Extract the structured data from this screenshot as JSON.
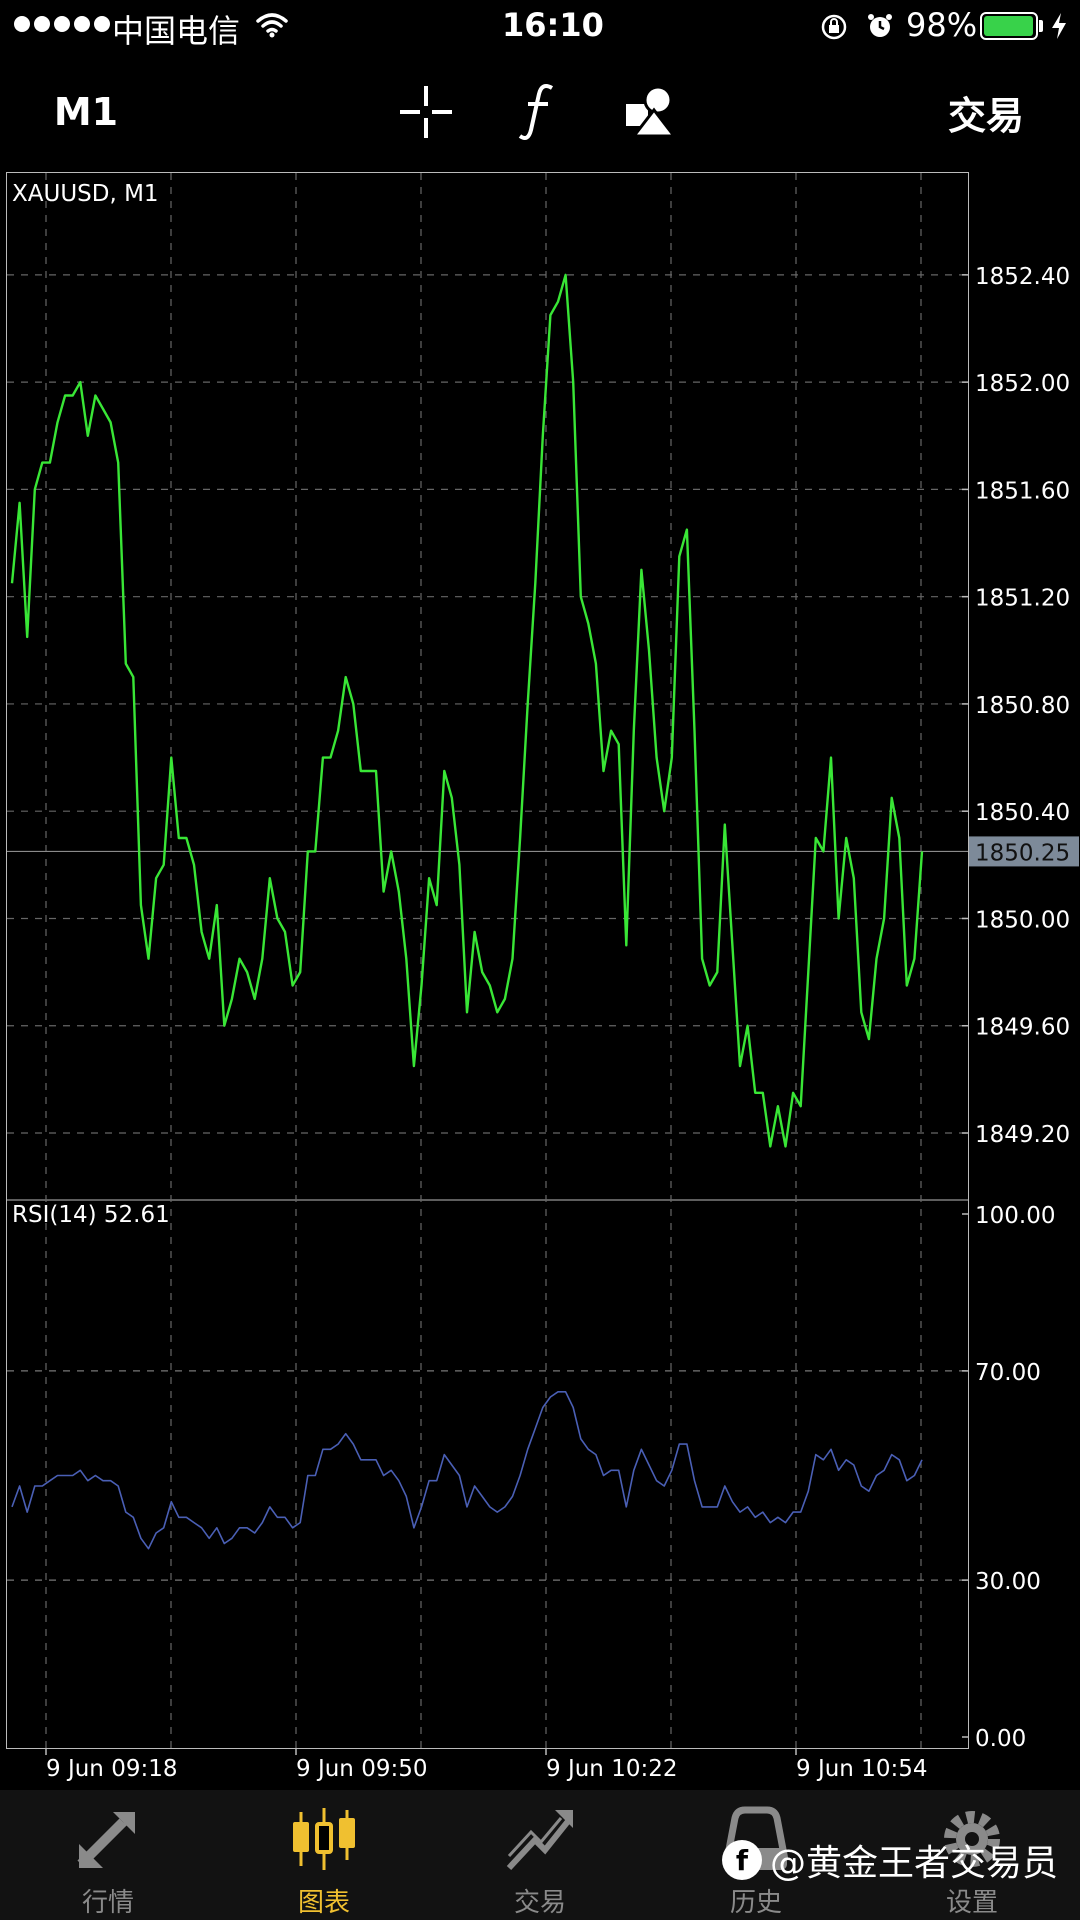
{
  "status_bar": {
    "carrier": "中国电信",
    "time": "16:10",
    "battery": "98%",
    "battery_level": 0.98,
    "icons": [
      "signal-dots-icon",
      "wifi-icon",
      "orientation-lock-icon",
      "alarm-icon",
      "battery-icon",
      "charging-icon"
    ]
  },
  "toolbar": {
    "timeframe": "M1",
    "crosshair_icon": "crosshair-icon",
    "indicators_icon": "function-icon",
    "objects_icon": "shapes-icon",
    "trade_label": "交易"
  },
  "chart": {
    "symbol_label": "XAUUSD, M1",
    "line_color": "#39e636",
    "rsi_color": "#4a5fb5",
    "current_price_label": "1850.25",
    "current_price": 1850.25,
    "rsi_label": "RSI(14) 52.61",
    "price_axis": [
      "1852.40",
      "1852.00",
      "1851.60",
      "1851.20",
      "1850.80",
      "1850.40",
      "1850.00",
      "1849.60",
      "1849.20"
    ],
    "rsi_axis": [
      "100.00",
      "70.00",
      "30.00",
      "0.00"
    ],
    "time_axis": [
      "9 Jun 09:18",
      "9 Jun 09:50",
      "9 Jun 10:22",
      "9 Jun 10:54"
    ]
  },
  "chart_data": {
    "type": "line",
    "title": "XAUUSD, M1",
    "series": [
      {
        "name": "XAUUSD, M1",
        "values": [
          1851.25,
          1851.55,
          1851.05,
          1851.6,
          1851.7,
          1851.7,
          1851.85,
          1851.95,
          1851.95,
          1852.0,
          1851.8,
          1851.95,
          1851.9,
          1851.85,
          1851.7,
          1850.95,
          1850.9,
          1850.05,
          1849.85,
          1850.15,
          1850.2,
          1850.6,
          1850.3,
          1850.3,
          1850.2,
          1849.95,
          1849.85,
          1850.05,
          1849.6,
          1849.7,
          1849.85,
          1849.8,
          1849.7,
          1849.85,
          1850.15,
          1850.0,
          1849.95,
          1849.75,
          1849.8,
          1850.25,
          1850.25,
          1850.6,
          1850.6,
          1850.7,
          1850.9,
          1850.8,
          1850.55,
          1850.55,
          1850.55,
          1850.1,
          1850.25,
          1850.1,
          1849.85,
          1849.45,
          1849.75,
          1850.15,
          1850.05,
          1850.55,
          1850.45,
          1850.2,
          1849.65,
          1849.95,
          1849.8,
          1849.75,
          1849.65,
          1849.7,
          1849.85,
          1850.3,
          1850.8,
          1851.25,
          1851.8,
          1852.25,
          1852.3,
          1852.4,
          1852.0,
          1851.2,
          1851.1,
          1850.95,
          1850.55,
          1850.7,
          1850.65,
          1849.9,
          1850.7,
          1851.3,
          1851.0,
          1850.6,
          1850.4,
          1850.6,
          1851.35,
          1851.45,
          1850.7,
          1849.85,
          1849.75,
          1849.8,
          1850.35,
          1849.9,
          1849.45,
          1849.6,
          1849.35,
          1849.35,
          1849.15,
          1849.3,
          1849.15,
          1849.35,
          1849.3,
          1849.8,
          1850.3,
          1850.25,
          1850.6,
          1850.0,
          1850.3,
          1850.15,
          1849.65,
          1849.55,
          1849.85,
          1850.0,
          1850.45,
          1850.3,
          1849.75,
          1849.85,
          1850.25
        ]
      },
      {
        "name": "RSI(14) 52.61",
        "values": [
          44,
          48,
          43,
          48,
          48,
          49,
          50,
          50,
          50,
          51,
          49,
          50,
          49,
          49,
          48,
          43,
          42,
          38,
          36,
          39,
          40,
          45,
          42,
          42,
          41,
          40,
          38,
          40,
          37,
          38,
          40,
          40,
          39,
          41,
          44,
          42,
          42,
          40,
          41,
          50,
          50,
          55,
          55,
          56,
          58,
          56,
          53,
          53,
          53,
          50,
          51,
          49,
          46,
          40,
          44,
          49,
          49,
          54,
          52,
          50,
          44,
          48,
          46,
          44,
          43,
          44,
          46,
          50,
          55,
          59,
          63,
          65,
          66,
          66,
          63,
          57,
          55,
          54,
          50,
          51,
          51,
          44,
          51,
          55,
          52,
          49,
          48,
          51,
          56,
          56,
          49,
          44,
          44,
          44,
          48,
          45,
          43,
          44,
          42,
          43,
          41,
          42,
          41,
          43,
          43,
          47,
          54,
          53,
          55,
          51,
          53,
          52,
          48,
          47,
          50,
          51,
          54,
          53,
          49,
          50,
          53
        ]
      }
    ],
    "ylim": [
      1848.98,
      1852.75
    ],
    "rsi_ylim": [
      0,
      100
    ],
    "yticks": [
      1849.2,
      1849.6,
      1850.0,
      1850.4,
      1850.8,
      1851.2,
      1851.6,
      1852.0,
      1852.4
    ],
    "rsi_levels": [
      70,
      30
    ],
    "x_ticks": [
      "9 Jun 09:18",
      "9 Jun 09:50",
      "9 Jun 10:22",
      "9 Jun 10:54"
    ],
    "grid": true,
    "xlabel": "",
    "ylabel": ""
  },
  "bottom_nav": {
    "items": [
      {
        "label": "行情",
        "icon": "quotes-arrows-icon",
        "active": false
      },
      {
        "label": "图表",
        "icon": "candlestick-icon",
        "active": true
      },
      {
        "label": "交易",
        "icon": "trade-trend-icon",
        "active": false
      },
      {
        "label": "历史",
        "icon": "history-icon",
        "active": false
      },
      {
        "label": "设置",
        "icon": "settings-gear-icon",
        "active": false
      }
    ],
    "active_color": "#f0c030",
    "inactive_color": "#8a8a8a"
  },
  "watermark": {
    "logo": "f",
    "text": "@黄金王者交易员"
  }
}
